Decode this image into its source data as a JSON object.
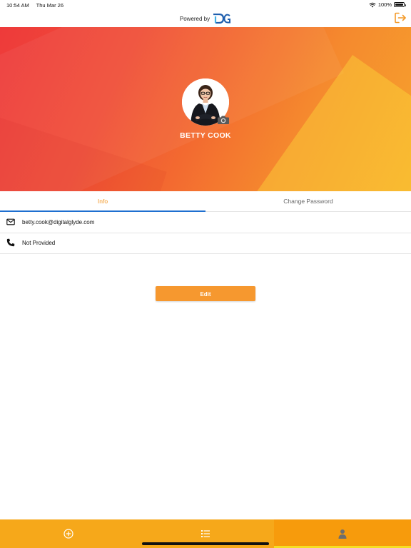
{
  "status_bar": {
    "time": "10:54 AM",
    "date": "Thu Mar 26",
    "battery": "100%",
    "icons": [
      "wifi-icon",
      "battery-icon"
    ]
  },
  "header": {
    "powered_by": "Powered by",
    "logo_text": "DG",
    "logout_icon": "logout-icon"
  },
  "profile": {
    "name": "BETTY COOK",
    "camera_icon": "camera-icon"
  },
  "tabs": [
    {
      "label": "Info",
      "active": true
    },
    {
      "label": "Change Password",
      "active": false
    }
  ],
  "info": {
    "email": "betty.cook@digitalglyde.com",
    "phone": "Not Provided"
  },
  "edit_button": {
    "label": "Edit"
  },
  "bottom_nav": {
    "items": [
      {
        "icon": "add-circle-icon",
        "active": false
      },
      {
        "icon": "list-icon",
        "active": false
      },
      {
        "icon": "user-icon",
        "active": true
      }
    ]
  },
  "colors": {
    "accent": "#f39a2a",
    "tab_indicator": "#1e6fd0",
    "nav_background": "#f6a81a",
    "nav_active_indicator": "#f5df23"
  }
}
